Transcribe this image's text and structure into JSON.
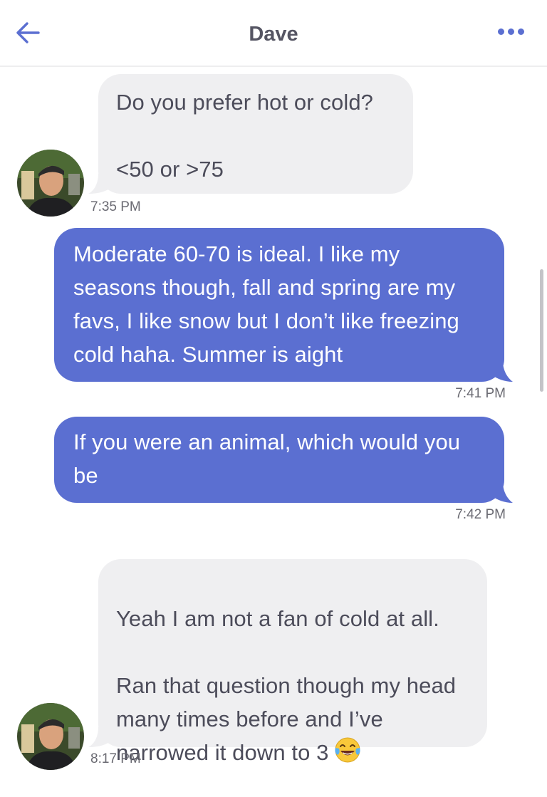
{
  "header": {
    "title": "Dave",
    "back_icon": "arrow-left-icon",
    "more_icon": "more-horizontal-icon",
    "accent_color": "#5b6fd1"
  },
  "messages": [
    {
      "direction": "incoming",
      "text": "Do you prefer hot or cold?\n\n<50 or >75",
      "time": "7:35 PM"
    },
    {
      "direction": "outgoing",
      "text": "Moderate 60-70 is ideal. I like my seasons though, fall and spring are my favs, I like snow but I don’t like freezing cold haha. Summer is aight",
      "time": "7:41 PM"
    },
    {
      "direction": "outgoing",
      "text": "If you were an animal, which would you be",
      "time": "7:42 PM"
    },
    {
      "direction": "incoming",
      "text": "Yeah I am not a fan of cold at all.\n\nRan that question though my head many times before and I’ve narrowed it down to 3",
      "emoji": "face-with-tears-of-joy",
      "time": "8:17 PM"
    }
  ],
  "colors": {
    "outgoing_bubble": "#5b6fd1",
    "incoming_bubble": "#efeff1"
  }
}
